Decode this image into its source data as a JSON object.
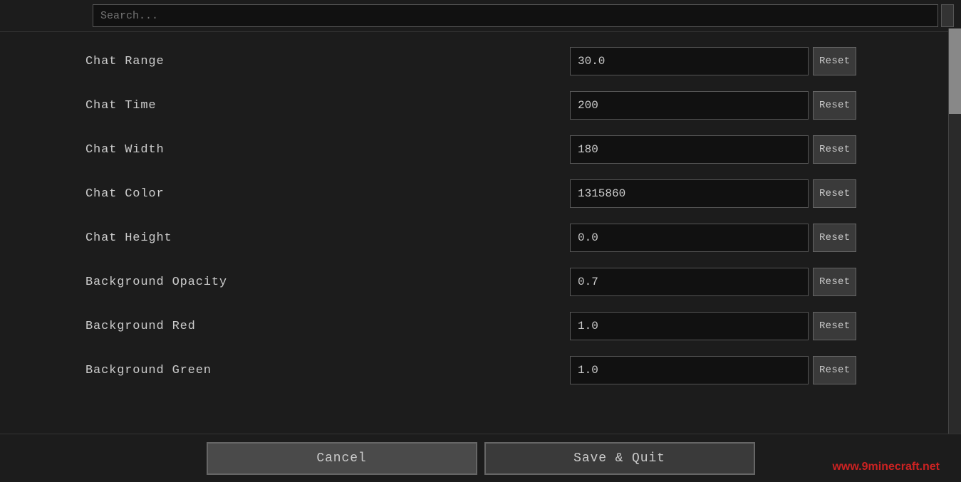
{
  "search": {
    "placeholder": "Search..."
  },
  "settings": {
    "rows": [
      {
        "label": "Chat Range",
        "value": "30.0"
      },
      {
        "label": "Chat Time",
        "value": "200"
      },
      {
        "label": "Chat Width",
        "value": "180"
      },
      {
        "label": "Chat Color",
        "value": "1315860"
      },
      {
        "label": "Chat Height",
        "value": "0.0"
      },
      {
        "label": "Background Opacity",
        "value": "0.7"
      },
      {
        "label": "Background Red",
        "value": "1.0"
      },
      {
        "label": "Background Green",
        "value": "1.0"
      }
    ],
    "reset_label": "Reset"
  },
  "footer": {
    "cancel_label": "Cancel",
    "save_quit_label": "Save & Quit"
  },
  "watermark": {
    "text": "www.9minecraft.net"
  }
}
